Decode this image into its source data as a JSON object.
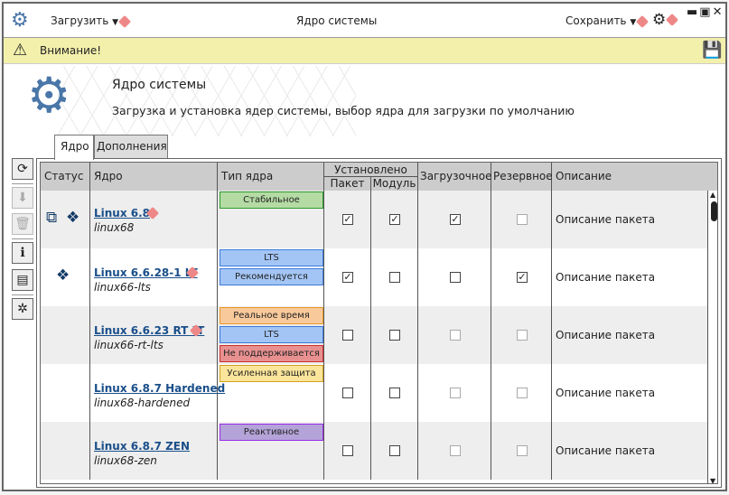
{
  "titlebar": {
    "load_label": "Загрузить",
    "title": "Ядро системы",
    "save_label": "Сохранить"
  },
  "warning": {
    "text": "Внимание!"
  },
  "header": {
    "title": "Ядро системы",
    "subtitle": "Загрузка и установка ядер системы, выбор ядра для загрузки по умолчанию"
  },
  "tabs": [
    {
      "label": "Ядро",
      "active": true
    },
    {
      "label": "Дополнения",
      "active": false
    }
  ],
  "columns": {
    "status": "Статус",
    "kernel": "Ядро",
    "type": "Тип ядра",
    "installed": "Установлено",
    "package": "Пакет",
    "module": "Модуль",
    "boot": "Загрузочное",
    "reserve": "Резервное",
    "description": "Описание"
  },
  "rows": [
    {
      "name": "Linux 6.8",
      "pkg": "linux68",
      "status": [
        "package",
        "module"
      ],
      "badges": [
        {
          "text": "Стабильное",
          "bg": "#b5dba5",
          "border": "#2a9a2a"
        }
      ],
      "package": true,
      "module": true,
      "boot": true,
      "reserve": false,
      "boot_disabled": false,
      "reserve_disabled": true,
      "desc": "Описание пакета"
    },
    {
      "name": "Linux 6.6.28-1 LT",
      "pkg": "linux66-lts",
      "status": [
        "module"
      ],
      "badges": [
        {
          "text": "LTS",
          "bg": "#a3c5f5",
          "border": "#3a7ad8"
        },
        {
          "text": "Рекомендуется",
          "bg": "#a3c5f5",
          "border": "#3a7ad8"
        }
      ],
      "package": true,
      "module": false,
      "boot": false,
      "reserve": true,
      "boot_disabled": false,
      "reserve_disabled": false,
      "desc": "Описание пакета"
    },
    {
      "name": "Linux 6.6.23 RT LT",
      "pkg": "linux66-rt-lts",
      "status": [],
      "badges": [
        {
          "text": "Реальное время",
          "bg": "#f8c99a",
          "border": "#e89a2a"
        },
        {
          "text": "LTS",
          "bg": "#a3c5f5",
          "border": "#3a7ad8"
        },
        {
          "text": "Не поддерживается",
          "bg": "#e89090",
          "border": "#c83030"
        }
      ],
      "package": false,
      "module": false,
      "boot": false,
      "reserve": false,
      "boot_disabled": true,
      "reserve_disabled": true,
      "desc": "Описание пакета"
    },
    {
      "name": "Linux 6.8.7 Hardened",
      "pkg": "linux68-hardened",
      "status": [],
      "badges": [
        {
          "text": "Усиленная защита",
          "bg": "#fbe59a",
          "border": "#d0a020"
        }
      ],
      "package": false,
      "module": false,
      "boot": false,
      "reserve": false,
      "boot_disabled": true,
      "reserve_disabled": true,
      "desc": "Описание пакета"
    },
    {
      "name": "Linux 6.8.7 ZEN",
      "pkg": "linux68-zen",
      "status": [],
      "badges": [
        {
          "text": "Реактивное",
          "bg": "#b4a3d8",
          "border": "#9a2ae8"
        }
      ],
      "package": false,
      "module": false,
      "boot": false,
      "reserve": false,
      "boot_disabled": true,
      "reserve_disabled": true,
      "desc": "Описание пакета"
    }
  ]
}
